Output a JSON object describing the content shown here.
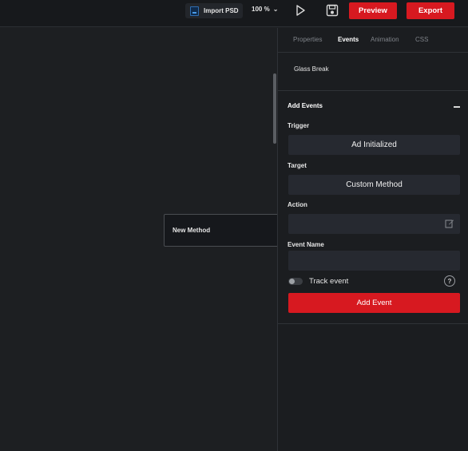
{
  "toolbar": {
    "import_label": "Import PSD",
    "zoom_value": "100 %",
    "preview_label": "Preview",
    "export_label": "Export",
    "accent_color": "#d71920"
  },
  "panel": {
    "tabs": [
      {
        "label": "Properties",
        "active": false
      },
      {
        "label": "Events",
        "active": true
      },
      {
        "label": "Animation",
        "active": false
      },
      {
        "label": "CSS",
        "active": false
      }
    ],
    "layer_name": "Glass Break",
    "section_title": "Add Events",
    "trigger": {
      "label": "Trigger",
      "value": "Ad Initialized"
    },
    "target": {
      "label": "Target",
      "value": "Custom Method"
    },
    "action": {
      "label": "Action",
      "value": ""
    },
    "event_name": {
      "label": "Event Name",
      "value": ""
    },
    "track_event": {
      "label": "Track event",
      "enabled": false
    },
    "help_glyph": "?",
    "add_event_label": "Add Event"
  },
  "canvas": {
    "popover_text": "New Method"
  },
  "icons": {
    "psd": "psd-file-icon",
    "zoom_chevron": "chevron-down-icon",
    "play": "play-icon",
    "save": "save-icon",
    "edit": "edit-icon",
    "collapse": "minus-icon",
    "help": "help-icon"
  }
}
